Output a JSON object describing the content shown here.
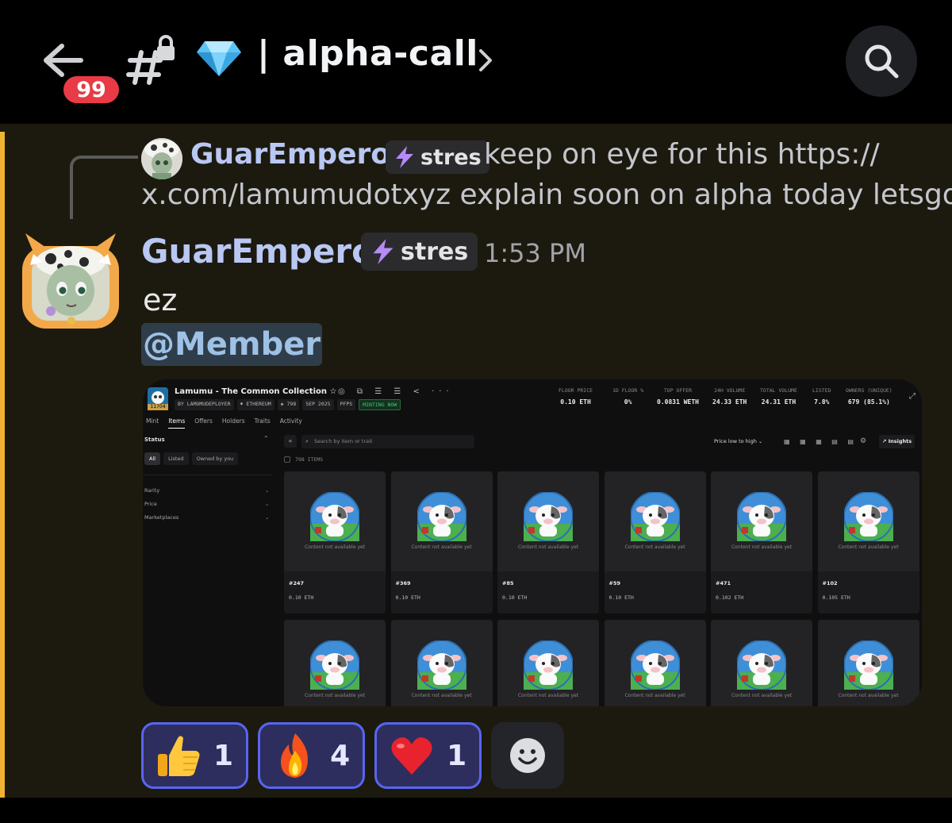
{
  "header": {
    "unread_badge": "99",
    "channel_name": "| alpha-call",
    "icons": [
      "back-arrow-icon",
      "locked-channel-icon",
      "gem-icon",
      "chevron-right-icon",
      "search-icon"
    ]
  },
  "reply": {
    "author": "GuarEmperor",
    "tag": "stres",
    "text_line1": "keep on eye for this  https://",
    "text_line2": "x.com/lamumudotxyz  explain soon on alpha today letsgo…"
  },
  "message": {
    "author": "GuarEmperor",
    "tag": "stres",
    "timestamp": "1:53 PM",
    "text": "ez",
    "mention": "@Member"
  },
  "embed": {
    "collection_title": "Lamumu - The Common Collection ☆",
    "title_icons": "◎ ⧉ ☰ ☰ < ···",
    "logo_tag": "11704",
    "meta": [
      "BY LAMUMUDEPLOYER",
      "♦ ETHEREUM",
      "◈ 798",
      "SEP 2025",
      "PFPS"
    ],
    "minting_label": "MINTING NOW",
    "stats": [
      {
        "label": "FLOOR PRICE",
        "value": "0.10 ETH"
      },
      {
        "label": "1D FLOOR %",
        "value": "0%"
      },
      {
        "label": "TOP OFFER",
        "value": "0.0831 WETH"
      },
      {
        "label": "24H VOLUME",
        "value": "24.33 ETH"
      },
      {
        "label": "TOTAL VOLUME",
        "value": "24.31 ETH"
      },
      {
        "label": "LISTED",
        "value": "7.8%"
      },
      {
        "label": "OWNERS (UNIQUE)",
        "value": "679 (85.1%)"
      }
    ],
    "tabs": [
      "Mint",
      "Items",
      "Offers",
      "Holders",
      "Traits",
      "Activity"
    ],
    "active_tab": "Items",
    "status_label": "Status",
    "status_pills": [
      "All",
      "Listed",
      "Owned by you"
    ],
    "filters": [
      "Rarity",
      "Price",
      "Marketplaces"
    ],
    "search_placeholder": "Search by item or trait",
    "sort_label": "Price low to high ⌄",
    "view_icons": "▦ ▦ ▦ ▤ ▤",
    "insights_label": "↗ Insights",
    "item_count": "798 ITEMS",
    "content_placeholder": "Content not available yet",
    "items": [
      {
        "id": "#247",
        "price": "0.10 ETH"
      },
      {
        "id": "#369",
        "price": "0.10 ETH"
      },
      {
        "id": "#85",
        "price": "0.10 ETH"
      },
      {
        "id": "#59",
        "price": "0.10 ETH"
      },
      {
        "id": "#471",
        "price": "0.102 ETH"
      },
      {
        "id": "#102",
        "price": "0.105 ETH"
      },
      {
        "id": "",
        "price": ""
      },
      {
        "id": "",
        "price": ""
      },
      {
        "id": "",
        "price": ""
      },
      {
        "id": "",
        "price": ""
      },
      {
        "id": "",
        "price": ""
      },
      {
        "id": "",
        "price": ""
      }
    ]
  },
  "reactions": [
    {
      "emoji": "thumbs-up",
      "count": "1"
    },
    {
      "emoji": "fire",
      "count": "4"
    },
    {
      "emoji": "red-heart",
      "count": "1"
    }
  ],
  "colors": {
    "accent": "#5865f2",
    "mention_bar": "#f0b232",
    "username": "#b9c7f3",
    "badge_red": "#e83b45"
  }
}
